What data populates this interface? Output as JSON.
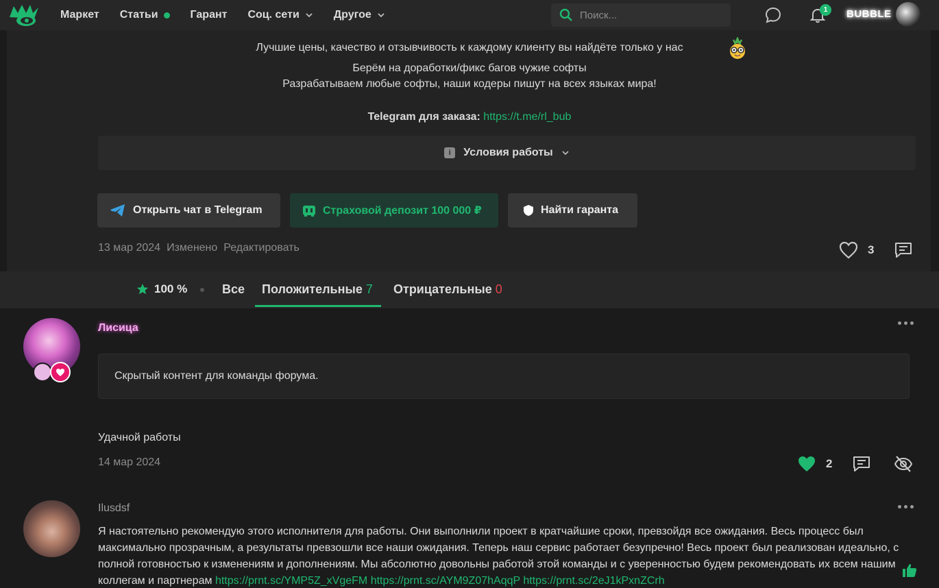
{
  "header": {
    "nav": [
      {
        "label": "Маркет"
      },
      {
        "label": "Статьи"
      },
      {
        "label": "Гарант"
      },
      {
        "label": "Соц. сети"
      },
      {
        "label": "Другое"
      }
    ],
    "search_placeholder": "Поиск...",
    "notifications_count": "1",
    "username": "BUBBLE"
  },
  "post": {
    "lines": [
      "Лучшие цены, качество и отзывчивость к каждому клиенту вы найдёте только у нас",
      "Берём на доработки/фикс багов чужие софты",
      "Разрабатываем любые софты, наши кодеры пишут на всех языках мира!"
    ],
    "telegram_label": "Telegram для заказа:",
    "telegram_link": "https://t.me/rl_bub",
    "conditions_label": "Условия работы",
    "buttons": {
      "telegram": "Открыть чат в Telegram",
      "deposit": "Страховой депозит 100 000 ₽",
      "guarantor": "Найти гаранта"
    },
    "date": "13 мар 2024",
    "edited": "Изменено",
    "edit": "Редактировать",
    "likes": "3"
  },
  "reviews_tabs": {
    "rating": "100 %",
    "all": "Все",
    "positive": "Положительные",
    "positive_count": "7",
    "negative": "Отрицательные",
    "negative_count": "0"
  },
  "reviews": [
    {
      "author": "Лисица",
      "hidden": "Скрытый контент для команды форума.",
      "text": "Удачной работы",
      "date": "14 мар 2024",
      "likes": "2"
    },
    {
      "author": "Ilusdsf",
      "text": "Я настоятельно рекомендую этого исполнителя для работы. Они выполнили проект в кратчайшие сроки, превзойдя все ожидания. Весь процесс был максимально прозрачным, а результаты превзошли все наши ожидания. Теперь наш сервис работает безупречно! Весь проект был реализован идеально, с полной готовностью к изменениям и дополнениям. Мы абсолютно довольны работой этой команды и с уверенностью будем рекомендовать их всем нашим коллегам и партнерам",
      "links": [
        "https://prnt.sc/YMP5Z_xVgeFM",
        "https://prnt.sc/AYM9Z07hAqqP",
        "https://prnt.sc/2eJ1kPxnZCrh"
      ]
    }
  ],
  "colors": {
    "accent": "#1fb870",
    "negative": "#e0454a",
    "background": "#1b1b1b"
  }
}
